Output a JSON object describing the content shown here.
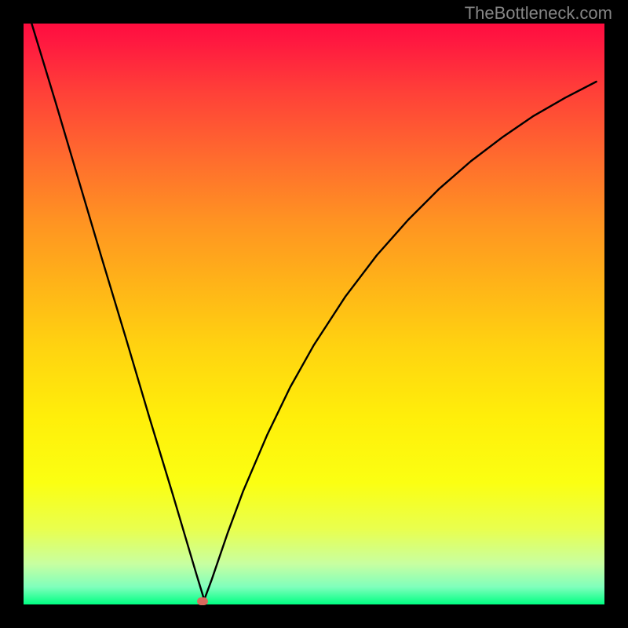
{
  "watermark": "TheBottleneck.com",
  "chart_data": {
    "type": "line",
    "title": "",
    "xlabel": "",
    "ylabel": "",
    "xlim": [
      0,
      1
    ],
    "ylim": [
      0,
      1
    ],
    "curve": {
      "note": "Two-branch bottleneck curve. x is normalized horizontal position (0=left edge of plot area, 1=right). y is normalized so 0=top, 1=bottom. Minimum (cusp) near x≈0.31 at bottom.",
      "left_branch": [
        {
          "x": 0.014,
          "y": 0.0
        },
        {
          "x": 0.055,
          "y": 0.135
        },
        {
          "x": 0.095,
          "y": 0.27
        },
        {
          "x": 0.135,
          "y": 0.405
        },
        {
          "x": 0.176,
          "y": 0.541
        },
        {
          "x": 0.216,
          "y": 0.676
        },
        {
          "x": 0.257,
          "y": 0.811
        },
        {
          "x": 0.297,
          "y": 0.946
        },
        {
          "x": 0.311,
          "y": 0.992
        }
      ],
      "right_branch": [
        {
          "x": 0.311,
          "y": 0.992
        },
        {
          "x": 0.324,
          "y": 0.957
        },
        {
          "x": 0.351,
          "y": 0.878
        },
        {
          "x": 0.378,
          "y": 0.805
        },
        {
          "x": 0.419,
          "y": 0.709
        },
        {
          "x": 0.459,
          "y": 0.626
        },
        {
          "x": 0.5,
          "y": 0.553
        },
        {
          "x": 0.554,
          "y": 0.47
        },
        {
          "x": 0.608,
          "y": 0.399
        },
        {
          "x": 0.662,
          "y": 0.338
        },
        {
          "x": 0.716,
          "y": 0.284
        },
        {
          "x": 0.77,
          "y": 0.237
        },
        {
          "x": 0.824,
          "y": 0.196
        },
        {
          "x": 0.878,
          "y": 0.159
        },
        {
          "x": 0.932,
          "y": 0.128
        },
        {
          "x": 0.986,
          "y": 0.1
        }
      ]
    },
    "marker": {
      "x": 0.308,
      "y": 0.994
    },
    "colors": {
      "background_frame": "#000000",
      "curve": "#000000",
      "marker": "#d96a5e",
      "gradient_top": "#ff0d3f",
      "gradient_bottom": "#00ff82"
    }
  }
}
